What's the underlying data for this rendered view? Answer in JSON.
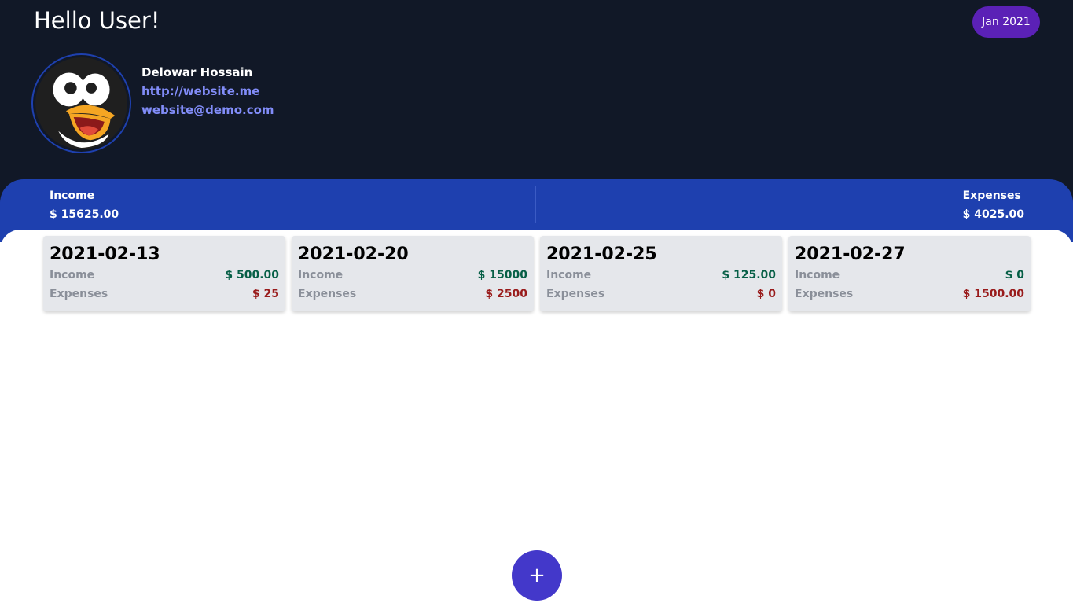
{
  "header": {
    "greeting": "Hello User!",
    "month_label": "Jan 2021"
  },
  "profile": {
    "avatar_icon": "penguin-avatar-icon",
    "name": "Delowar Hossain",
    "website": "http://website.me",
    "email": "website@demo.com"
  },
  "summary": {
    "income_label": "Income",
    "income_value": "$ 15625.00",
    "expenses_label": "Expenses",
    "expenses_value": "$ 4025.00"
  },
  "colors": {
    "header_bg": "#111827",
    "summary_bg": "#1e40af",
    "pill_bg": "#5b21b6",
    "fab_bg": "#4338ca",
    "income_text": "#065f46",
    "expense_text": "#991b1b"
  },
  "cards": [
    {
      "date": "2021-02-13",
      "income_label": "Income",
      "income": "$ 500.00",
      "expenses_label": "Expenses",
      "expenses": "$ 25"
    },
    {
      "date": "2021-02-20",
      "income_label": "Income",
      "income": "$ 15000",
      "expenses_label": "Expenses",
      "expenses": "$ 2500"
    },
    {
      "date": "2021-02-25",
      "income_label": "Income",
      "income": "$ 125.00",
      "expenses_label": "Expenses",
      "expenses": "$ 0"
    },
    {
      "date": "2021-02-27",
      "income_label": "Income",
      "income": "$ 0",
      "expenses_label": "Expenses",
      "expenses": "$ 1500.00"
    }
  ],
  "fab": {
    "label": "+",
    "icon": "plus-icon"
  }
}
